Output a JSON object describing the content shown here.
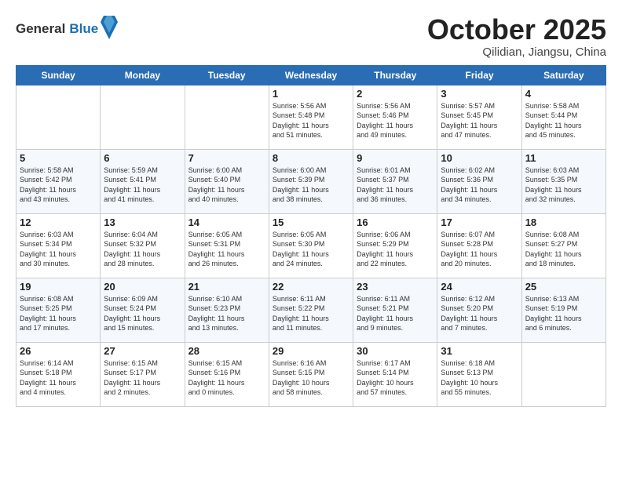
{
  "header": {
    "logo_general": "General",
    "logo_blue": "Blue",
    "month_title": "October 2025",
    "location": "Qilidian, Jiangsu, China"
  },
  "days_of_week": [
    "Sunday",
    "Monday",
    "Tuesday",
    "Wednesday",
    "Thursday",
    "Friday",
    "Saturday"
  ],
  "weeks": [
    [
      {
        "day": "",
        "info": ""
      },
      {
        "day": "",
        "info": ""
      },
      {
        "day": "",
        "info": ""
      },
      {
        "day": "1",
        "info": "Sunrise: 5:56 AM\nSunset: 5:48 PM\nDaylight: 11 hours\nand 51 minutes."
      },
      {
        "day": "2",
        "info": "Sunrise: 5:56 AM\nSunset: 5:46 PM\nDaylight: 11 hours\nand 49 minutes."
      },
      {
        "day": "3",
        "info": "Sunrise: 5:57 AM\nSunset: 5:45 PM\nDaylight: 11 hours\nand 47 minutes."
      },
      {
        "day": "4",
        "info": "Sunrise: 5:58 AM\nSunset: 5:44 PM\nDaylight: 11 hours\nand 45 minutes."
      }
    ],
    [
      {
        "day": "5",
        "info": "Sunrise: 5:58 AM\nSunset: 5:42 PM\nDaylight: 11 hours\nand 43 minutes."
      },
      {
        "day": "6",
        "info": "Sunrise: 5:59 AM\nSunset: 5:41 PM\nDaylight: 11 hours\nand 41 minutes."
      },
      {
        "day": "7",
        "info": "Sunrise: 6:00 AM\nSunset: 5:40 PM\nDaylight: 11 hours\nand 40 minutes."
      },
      {
        "day": "8",
        "info": "Sunrise: 6:00 AM\nSunset: 5:39 PM\nDaylight: 11 hours\nand 38 minutes."
      },
      {
        "day": "9",
        "info": "Sunrise: 6:01 AM\nSunset: 5:37 PM\nDaylight: 11 hours\nand 36 minutes."
      },
      {
        "day": "10",
        "info": "Sunrise: 6:02 AM\nSunset: 5:36 PM\nDaylight: 11 hours\nand 34 minutes."
      },
      {
        "day": "11",
        "info": "Sunrise: 6:03 AM\nSunset: 5:35 PM\nDaylight: 11 hours\nand 32 minutes."
      }
    ],
    [
      {
        "day": "12",
        "info": "Sunrise: 6:03 AM\nSunset: 5:34 PM\nDaylight: 11 hours\nand 30 minutes."
      },
      {
        "day": "13",
        "info": "Sunrise: 6:04 AM\nSunset: 5:32 PM\nDaylight: 11 hours\nand 28 minutes."
      },
      {
        "day": "14",
        "info": "Sunrise: 6:05 AM\nSunset: 5:31 PM\nDaylight: 11 hours\nand 26 minutes."
      },
      {
        "day": "15",
        "info": "Sunrise: 6:05 AM\nSunset: 5:30 PM\nDaylight: 11 hours\nand 24 minutes."
      },
      {
        "day": "16",
        "info": "Sunrise: 6:06 AM\nSunset: 5:29 PM\nDaylight: 11 hours\nand 22 minutes."
      },
      {
        "day": "17",
        "info": "Sunrise: 6:07 AM\nSunset: 5:28 PM\nDaylight: 11 hours\nand 20 minutes."
      },
      {
        "day": "18",
        "info": "Sunrise: 6:08 AM\nSunset: 5:27 PM\nDaylight: 11 hours\nand 18 minutes."
      }
    ],
    [
      {
        "day": "19",
        "info": "Sunrise: 6:08 AM\nSunset: 5:25 PM\nDaylight: 11 hours\nand 17 minutes."
      },
      {
        "day": "20",
        "info": "Sunrise: 6:09 AM\nSunset: 5:24 PM\nDaylight: 11 hours\nand 15 minutes."
      },
      {
        "day": "21",
        "info": "Sunrise: 6:10 AM\nSunset: 5:23 PM\nDaylight: 11 hours\nand 13 minutes."
      },
      {
        "day": "22",
        "info": "Sunrise: 6:11 AM\nSunset: 5:22 PM\nDaylight: 11 hours\nand 11 minutes."
      },
      {
        "day": "23",
        "info": "Sunrise: 6:11 AM\nSunset: 5:21 PM\nDaylight: 11 hours\nand 9 minutes."
      },
      {
        "day": "24",
        "info": "Sunrise: 6:12 AM\nSunset: 5:20 PM\nDaylight: 11 hours\nand 7 minutes."
      },
      {
        "day": "25",
        "info": "Sunrise: 6:13 AM\nSunset: 5:19 PM\nDaylight: 11 hours\nand 6 minutes."
      }
    ],
    [
      {
        "day": "26",
        "info": "Sunrise: 6:14 AM\nSunset: 5:18 PM\nDaylight: 11 hours\nand 4 minutes."
      },
      {
        "day": "27",
        "info": "Sunrise: 6:15 AM\nSunset: 5:17 PM\nDaylight: 11 hours\nand 2 minutes."
      },
      {
        "day": "28",
        "info": "Sunrise: 6:15 AM\nSunset: 5:16 PM\nDaylight: 11 hours\nand 0 minutes."
      },
      {
        "day": "29",
        "info": "Sunrise: 6:16 AM\nSunset: 5:15 PM\nDaylight: 10 hours\nand 58 minutes."
      },
      {
        "day": "30",
        "info": "Sunrise: 6:17 AM\nSunset: 5:14 PM\nDaylight: 10 hours\nand 57 minutes."
      },
      {
        "day": "31",
        "info": "Sunrise: 6:18 AM\nSunset: 5:13 PM\nDaylight: 10 hours\nand 55 minutes."
      },
      {
        "day": "",
        "info": ""
      }
    ]
  ]
}
